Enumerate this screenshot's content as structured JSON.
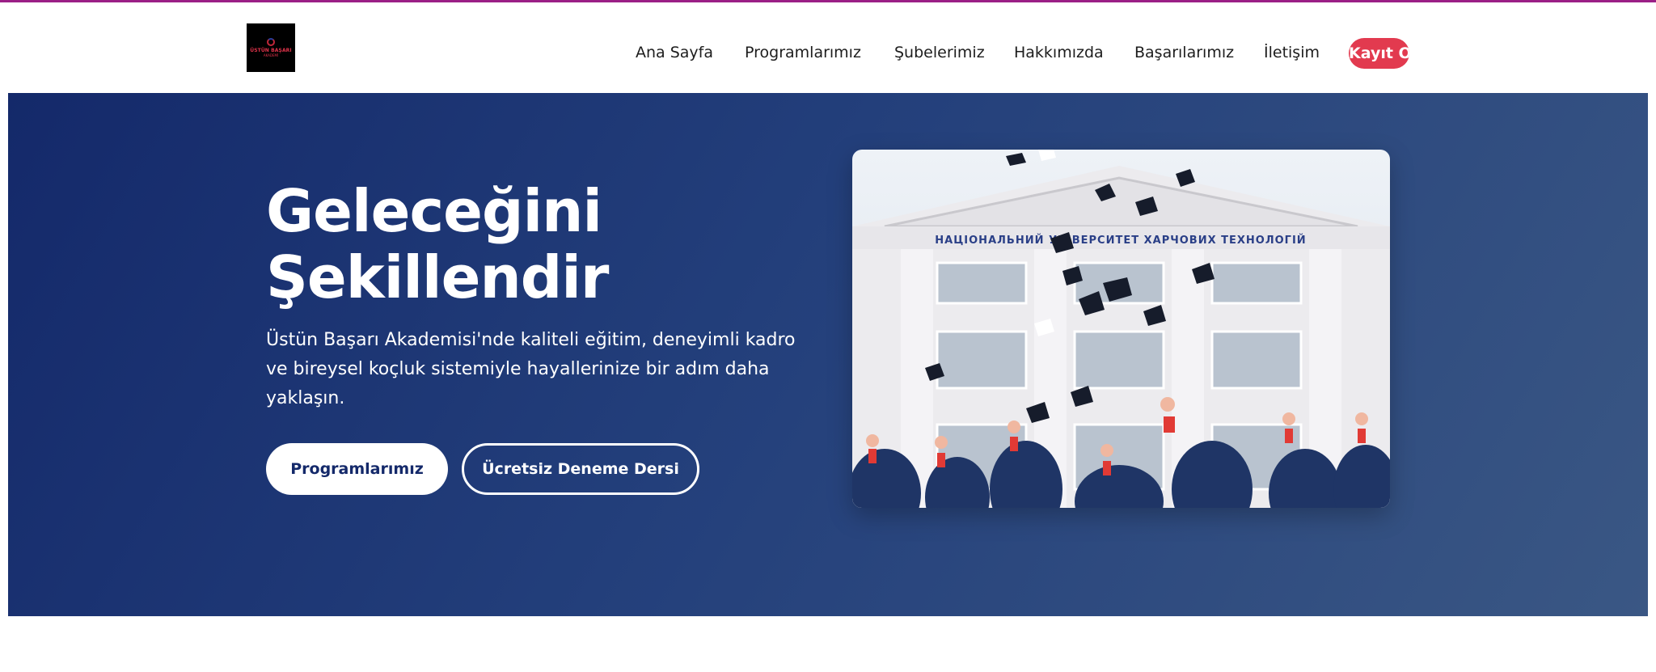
{
  "logo": {
    "name": "ÜSTÜN BAŞARI",
    "sub": "AKADEMİ"
  },
  "nav": {
    "items": [
      {
        "label": "Ana Sayfa"
      },
      {
        "label": "Programlarımız"
      },
      {
        "label": "Şubelerimiz"
      },
      {
        "label": "Hakkımızda"
      },
      {
        "label": "Başarılarımız"
      },
      {
        "label": "İletişim"
      }
    ],
    "cta_label": "Kayıt Ol"
  },
  "hero": {
    "title_line1": "Geleceğini",
    "title_line2": "Şekillendir",
    "description": "Üstün Başarı Akademisi'nde kaliteli eğitim, deneyimli kadro ve bireysel koçluk sistemiyle hayallerinize bir adım daha yaklaşın.",
    "primary_button": "Programlarımız",
    "secondary_button": "Ücretsiz Deneme Dersi",
    "image_building_text": "НАЦІОНАЛЬНИЙ УНІВЕРСИТЕТ ХАРЧОВИХ ТЕХНОЛОГІЙ"
  },
  "colors": {
    "accent": "#e23a4f",
    "hero_start": "#14296a",
    "hero_end": "#3a5784",
    "top_line": "#9b1f86"
  }
}
